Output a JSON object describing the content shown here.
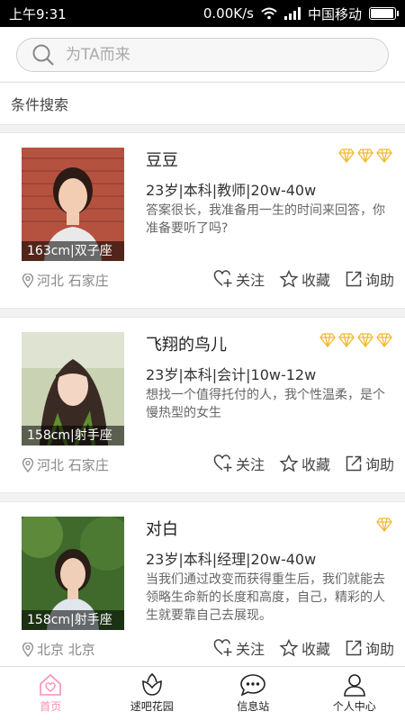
{
  "status": {
    "time": "上午9:31",
    "speed": "0.00K/s",
    "carrier": "中国移动",
    "battery_level": 0.9
  },
  "search": {
    "placeholder": "为TA而来",
    "icon": "search-icon"
  },
  "filter": {
    "label": "条件搜索"
  },
  "actions": {
    "follow": "关注",
    "favorite": "收藏",
    "inquire": "询助"
  },
  "colors": {
    "accent": "#f590b6",
    "gem": "#f2b935",
    "muted": "#888888"
  },
  "profiles": [
    {
      "name": "豆豆",
      "info": "23岁|本科|教师|20w-40w",
      "bio": "答案很长，我准备用一生的时间来回答，你准备要听了吗?",
      "caption": "163cm|双子座",
      "location": "河北 石家庄",
      "gems": 3
    },
    {
      "name": "飞翔的鸟儿",
      "info": "23岁|本科|会计|10w-12w",
      "bio": "想找一个值得托付的人，我个性温柔，是个慢热型的女生",
      "caption": "158cm|射手座",
      "location": "河北 石家庄",
      "gems": 4
    },
    {
      "name": "对白",
      "info": "23岁|本科|经理|20w-40w",
      "bio": "当我们通过改变而获得重生后，我们就能去领略生命新的长度和高度，自己，精彩的人生就要靠自己去展现。",
      "caption": "158cm|射手座",
      "location": "北京 北京",
      "gems": 1
    }
  ],
  "tabs": [
    {
      "label": "首页",
      "icon": "home-icon",
      "active": true
    },
    {
      "label": "逑吧花园",
      "icon": "flower-icon",
      "active": false
    },
    {
      "label": "信息站",
      "icon": "chat-icon",
      "active": false
    },
    {
      "label": "个人中心",
      "icon": "user-icon",
      "active": false
    }
  ]
}
